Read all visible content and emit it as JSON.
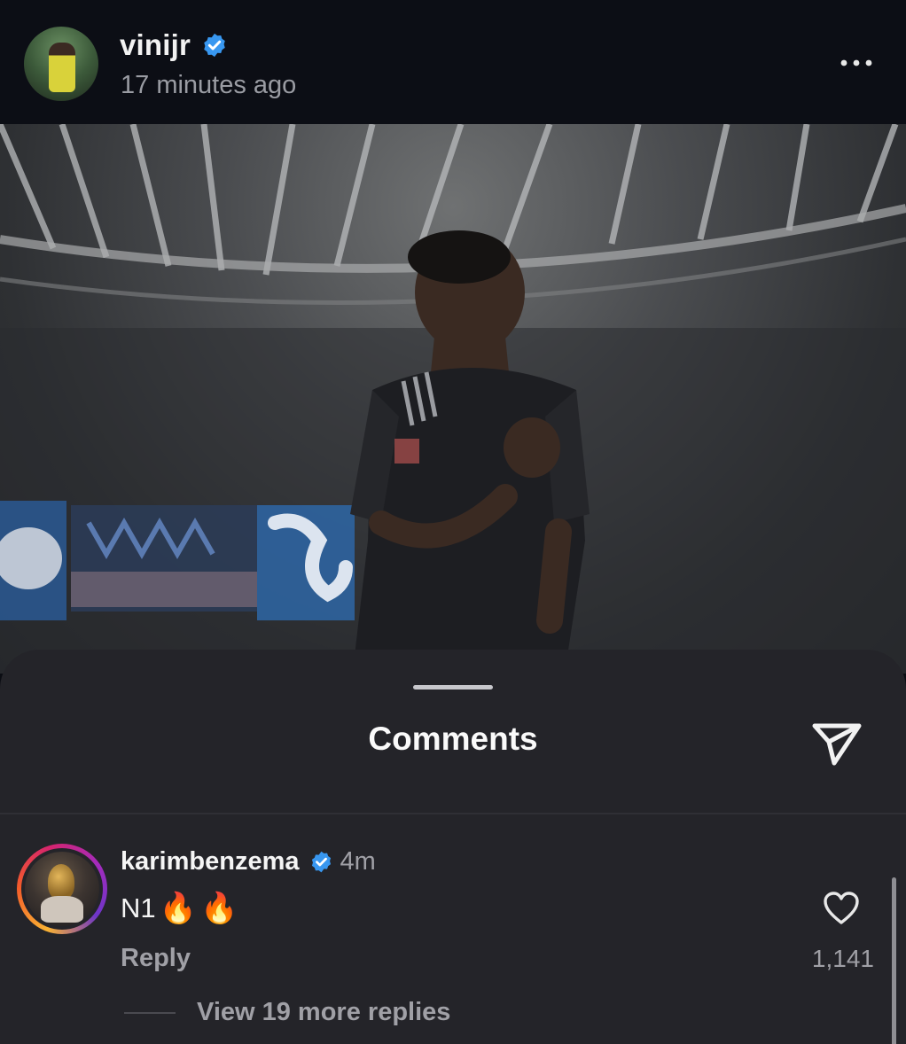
{
  "post": {
    "username": "vinijr",
    "time": "17 minutes ago",
    "verified": true,
    "icons": {
      "verified": "verified-badge-icon",
      "more": "more-options-icon"
    }
  },
  "sheet": {
    "title": "Comments",
    "icons": {
      "send": "send-icon"
    }
  },
  "comment": {
    "username": "karimbenzema",
    "verified": true,
    "time": "4m",
    "text": "N1",
    "emojis": [
      "🔥",
      "🔥"
    ],
    "reply_label": "Reply",
    "like_count": "1,141",
    "view_replies": "View 19 more replies",
    "icons": {
      "like": "heart-icon"
    }
  },
  "colors": {
    "background": "#0c0e15",
    "sheet": "#242429",
    "verified": "#3897f0",
    "secondary_text": "#a0a0a6"
  }
}
